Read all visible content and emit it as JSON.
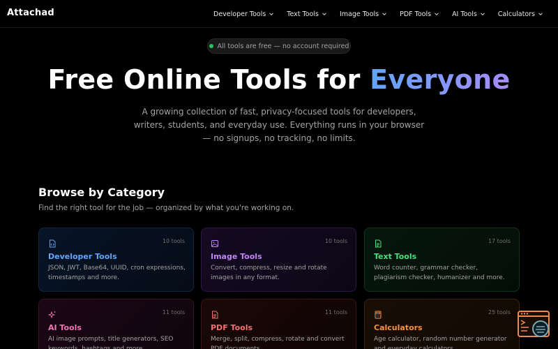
{
  "brand": "Attachad",
  "nav": [
    {
      "label": "Developer Tools"
    },
    {
      "label": "Text Tools"
    },
    {
      "label": "Image Tools"
    },
    {
      "label": "PDF Tools"
    },
    {
      "label": "AI Tools"
    },
    {
      "label": "Calculators"
    }
  ],
  "hero": {
    "badge": "All tools are free — no account required",
    "title_main": "Free Online Tools for ",
    "title_accent": "Everyone",
    "subtitle": "A growing collection of fast, privacy-focused tools for developers, writers, students, and everyday use. Everything runs in your browser — no signups, no tracking, no limits."
  },
  "section": {
    "title": "Browse by Category",
    "subtitle": "Find the right tool for the job — organized by what you're working on."
  },
  "categories": [
    {
      "title": "Developer Tools",
      "count": "10 tools",
      "desc": "JSON, JWT, Base64, UUID, cron expressions, timestamps and more.",
      "icon": "code-file-icon",
      "color": "#60a5fa"
    },
    {
      "title": "Image Tools",
      "count": "10 tools",
      "desc": "Convert, compress, resize and rotate images in any format.",
      "icon": "image-icon",
      "color": "#c084fc"
    },
    {
      "title": "Text Tools",
      "count": "17 tools",
      "desc": "Word counter, grammar checker, plagiarism checker, humanizer and more.",
      "icon": "text-file-icon",
      "color": "#4ade80"
    },
    {
      "title": "AI Tools",
      "count": "11 tools",
      "desc": "AI image prompts, title generators, SEO keywords, hashtags and more.",
      "icon": "sparkles-icon",
      "color": "#f472b6"
    },
    {
      "title": "PDF Tools",
      "count": "11 tools",
      "desc": "Merge, split, compress, rotate and convert PDF documents.",
      "icon": "pdf-file-icon",
      "color": "#f87171"
    },
    {
      "title": "Calculators",
      "count": "25 tools",
      "desc": "Age calculator, random number generator and everyday calculators.",
      "icon": "calculator-icon",
      "color": "#fb923c"
    }
  ]
}
